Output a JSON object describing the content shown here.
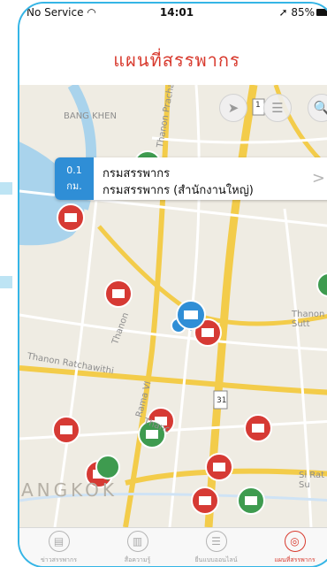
{
  "status_bar": {
    "carrier": "No Service",
    "time": "14:01",
    "battery": "85%"
  },
  "nav": {
    "title": "แผนที่สรรพากร"
  },
  "map": {
    "labels": {
      "bang_khen": "BANG KHEN",
      "thanon_prachachuen": "Thanon Prachachuen",
      "thanon_sutthisan": "Thanon Sutt",
      "thanon_ratchawithi": "Thanon Ratchawithi",
      "rama_vi": "Rama VI",
      "thanon_2": "Thanon",
      "thanon_3": "Thanc",
      "si_rat": "Si Rat Su",
      "bangkok": "ANGKOK",
      "highway_1": "1",
      "highway_31": "31"
    },
    "buttons": {
      "locate": "➤",
      "list": "☰",
      "search": "🔍"
    }
  },
  "callout": {
    "distance_value": "0.1",
    "distance_unit": "กม.",
    "title": "กรมสรรพากร",
    "subtitle": "กรมสรรพากร (สำนักงานใหญ่)",
    "chevron": ">"
  },
  "tabs": [
    {
      "label": "ข่าวสรรพากร",
      "icon": "news-icon",
      "glyph": "▤"
    },
    {
      "label": "สื่อความรู้",
      "icon": "book-icon",
      "glyph": "▥"
    },
    {
      "label": "ยื่นแบบออนไลน์",
      "icon": "form-icon",
      "glyph": "☰"
    },
    {
      "label": "แผนที่สรรพากร",
      "icon": "map-pin-icon",
      "glyph": "◎"
    }
  ],
  "colors": {
    "accent": "#d83a2e",
    "frame": "#35b5e6",
    "pin_red": "#d63a34",
    "pin_green": "#3e9b4f",
    "pin_blue": "#2f8ed6",
    "road_yellow": "#f3cc4a"
  }
}
